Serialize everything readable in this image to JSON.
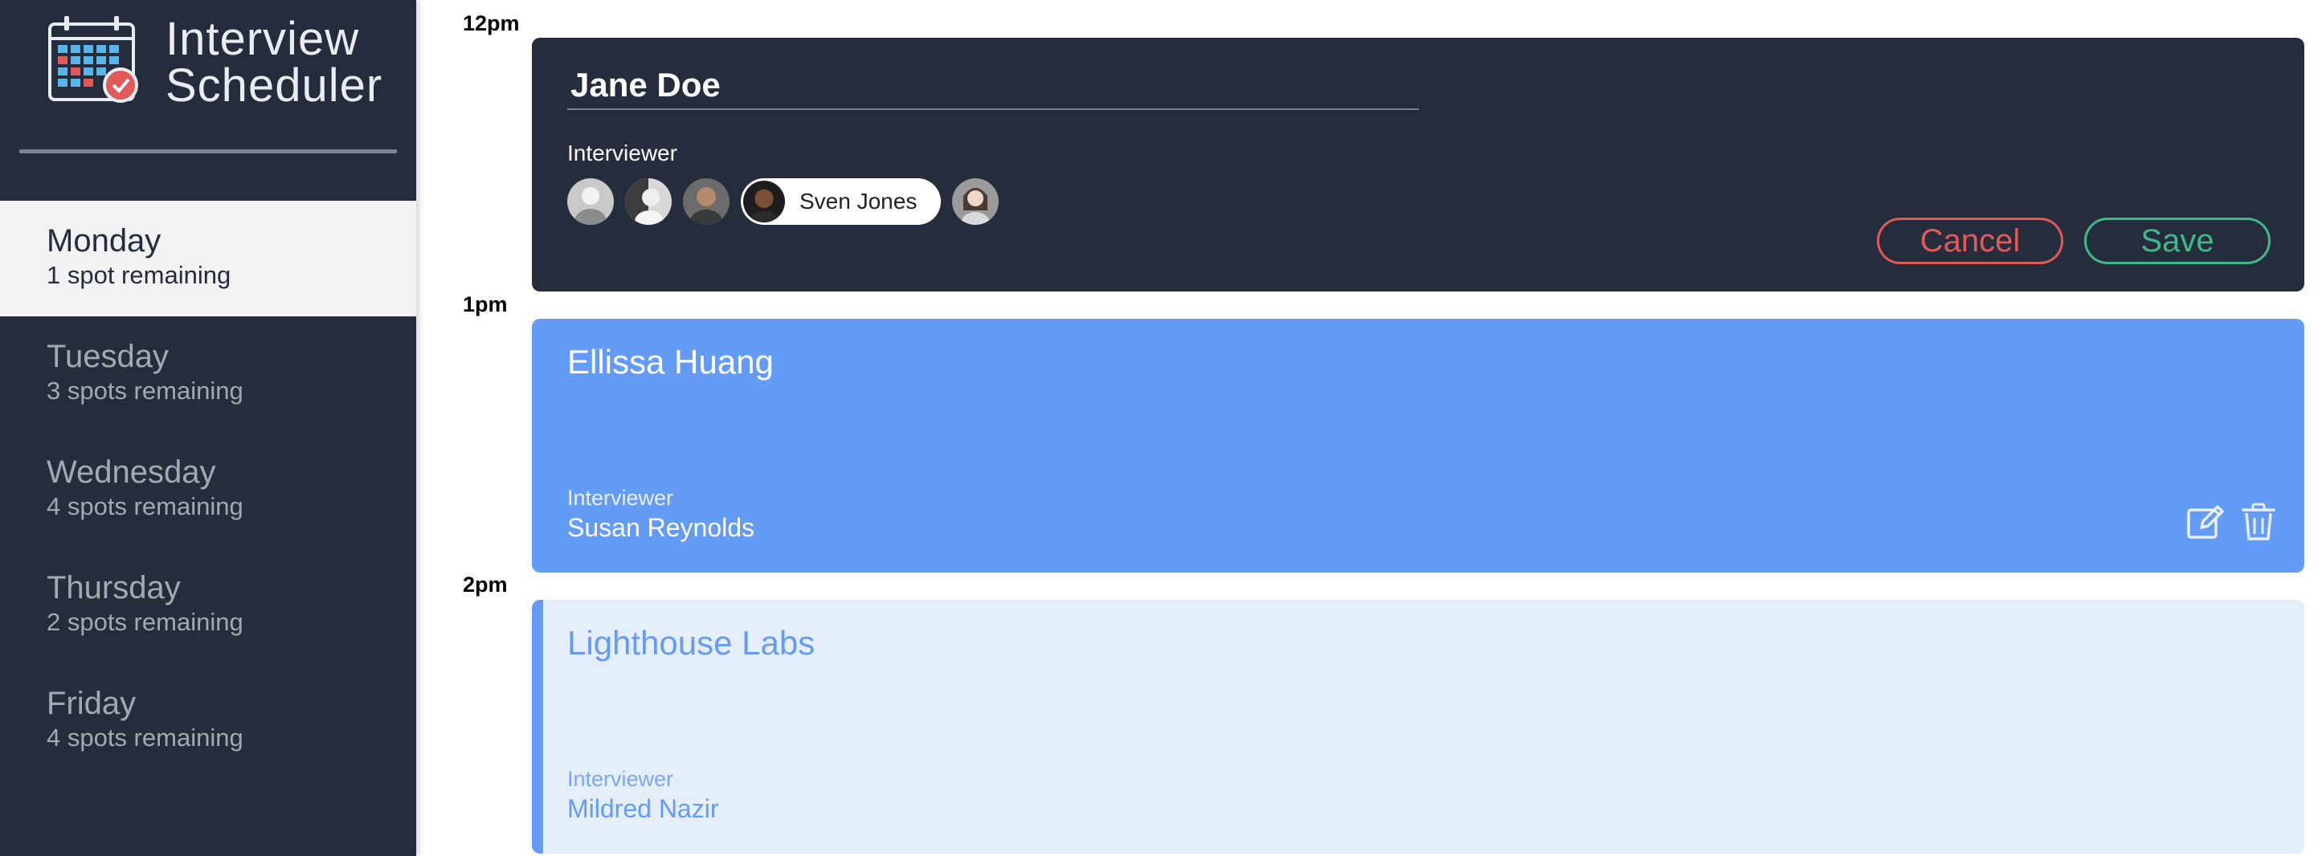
{
  "app": {
    "title_line1": "Interview",
    "title_line2": "Scheduler",
    "logo_icon": "calendar-check-icon"
  },
  "sidebar": {
    "days": [
      {
        "name": "Monday",
        "spots": "1 spot remaining",
        "selected": true
      },
      {
        "name": "Tuesday",
        "spots": "3 spots remaining",
        "selected": false
      },
      {
        "name": "Wednesday",
        "spots": "4 spots remaining",
        "selected": false
      },
      {
        "name": "Thursday",
        "spots": "2 spots remaining",
        "selected": false
      },
      {
        "name": "Friday",
        "spots": "4 spots remaining",
        "selected": false
      }
    ]
  },
  "schedule": {
    "times": [
      "12pm",
      "1pm",
      "2pm"
    ],
    "form": {
      "student_name": "Jane Doe",
      "interviewer_label": "Interviewer",
      "selected_interviewer": "Sven Jones",
      "cancel_label": "Cancel",
      "save_label": "Save"
    },
    "booked": {
      "student": "Ellissa Huang",
      "interviewer_label": "Interviewer",
      "interviewer": "Susan Reynolds",
      "edit_icon": "edit-icon",
      "delete_icon": "trash-icon"
    },
    "next": {
      "student": "Lighthouse Labs",
      "interviewer_label": "Interviewer",
      "interviewer": "Mildred Nazir"
    }
  },
  "colors": {
    "sidebar_bg": "#252d3d",
    "booked_bg": "#649bf6",
    "light_bg": "#e5effc",
    "cancel": "#e05a5a",
    "save": "#3fb98a"
  }
}
